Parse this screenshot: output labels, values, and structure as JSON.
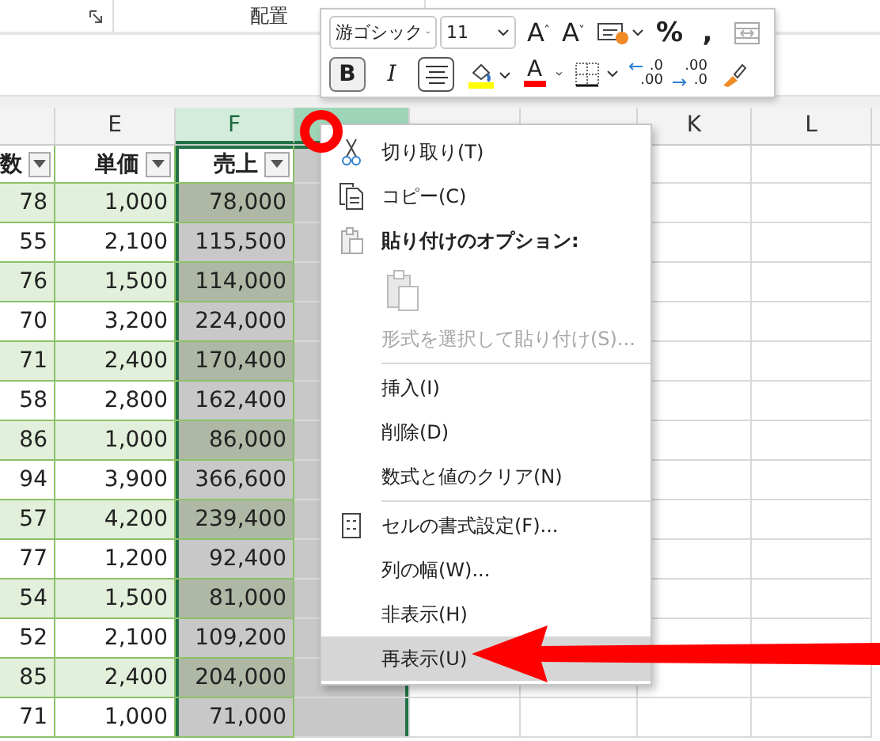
{
  "ribbon": {
    "group_label": "配置"
  },
  "columns": [
    {
      "selected": false,
      "hovered": false
    },
    {
      "letter": "E",
      "selected": false,
      "hovered": false
    },
    {
      "letter": "F",
      "selected": true,
      "hovered": false
    },
    {
      "selected": true,
      "hovered": true
    },
    {
      "selected": false,
      "hovered": false
    },
    {
      "selected": false,
      "hovered": false
    },
    {
      "letter": "K",
      "selected": false,
      "hovered": false
    },
    {
      "letter": "L",
      "selected": false,
      "hovered": false
    }
  ],
  "table": {
    "headers": [
      "数",
      "単価",
      "売上"
    ],
    "rows": [
      {
        "banded": true,
        "cells": [
          "78",
          "1,000",
          "78,000"
        ]
      },
      {
        "banded": false,
        "cells": [
          "55",
          "2,100",
          "115,500"
        ]
      },
      {
        "banded": true,
        "cells": [
          "76",
          "1,500",
          "114,000"
        ]
      },
      {
        "banded": false,
        "cells": [
          "70",
          "3,200",
          "224,000"
        ]
      },
      {
        "banded": true,
        "cells": [
          "71",
          "2,400",
          "170,400"
        ]
      },
      {
        "banded": false,
        "cells": [
          "58",
          "2,800",
          "162,400"
        ]
      },
      {
        "banded": true,
        "cells": [
          "86",
          "1,000",
          "86,000"
        ]
      },
      {
        "banded": false,
        "cells": [
          "94",
          "3,900",
          "366,600"
        ]
      },
      {
        "banded": true,
        "cells": [
          "57",
          "4,200",
          "239,400"
        ]
      },
      {
        "banded": false,
        "cells": [
          "77",
          "1,200",
          "92,400"
        ]
      },
      {
        "banded": true,
        "cells": [
          "54",
          "1,500",
          "81,000"
        ]
      },
      {
        "banded": false,
        "cells": [
          "52",
          "2,100",
          "109,200"
        ]
      },
      {
        "banded": true,
        "cells": [
          "85",
          "2,400",
          "204,000"
        ]
      },
      {
        "banded": false,
        "cells": [
          "71",
          "1,000",
          "71,000"
        ]
      }
    ]
  },
  "mini_toolbar": {
    "row1": [
      {
        "kind": "font",
        "value": "游ゴシック"
      },
      {
        "kind": "size",
        "value": "11"
      },
      {
        "kind": "grow",
        "label": "A"
      },
      {
        "kind": "shrink",
        "label": "A"
      },
      {
        "kind": "cond"
      },
      {
        "kind": "text",
        "label": "%"
      },
      {
        "kind": "text",
        "label": ","
      },
      {
        "kind": "merge"
      }
    ],
    "row2": [
      {
        "kind": "bold",
        "label": "B",
        "pressed": true
      },
      {
        "kind": "italic",
        "label": "I",
        "pressed": false
      },
      {
        "kind": "align",
        "pressed": true
      },
      {
        "kind": "fill",
        "color": "#ffff00"
      },
      {
        "kind": "fontcolor",
        "label": "A",
        "color": "#ff0000"
      },
      {
        "kind": "border"
      },
      {
        "kind": "decimal-decrease",
        "top": ".0",
        "bottom": ".00"
      },
      {
        "kind": "decimal-increase",
        "top": ".00",
        "bottom": ".0"
      },
      {
        "kind": "painter"
      }
    ]
  },
  "context_menu": [
    {
      "kind": "cut",
      "label": "切り取り(T)",
      "disabled": false,
      "selected": false
    },
    {
      "kind": "copy",
      "label": "コピー(C)",
      "disabled": false,
      "selected": false
    },
    {
      "kind": "paste-options",
      "label": "貼り付けのオプション:",
      "disabled": false,
      "selected": false
    },
    {
      "kind": "paste-button",
      "disabled": true,
      "selected": false
    },
    {
      "kind": "plain",
      "label": "形式を選択して貼り付け(S)...",
      "disabled": true,
      "selected": false
    },
    {
      "kind": "separator"
    },
    {
      "kind": "plain",
      "label": "挿入(I)",
      "disabled": false,
      "selected": false
    },
    {
      "kind": "plain",
      "label": "削除(D)",
      "disabled": false,
      "selected": false
    },
    {
      "kind": "plain",
      "label": "数式と値のクリア(N)",
      "disabled": false,
      "selected": false
    },
    {
      "kind": "separator"
    },
    {
      "kind": "format",
      "label": "セルの書式設定(F)...",
      "disabled": false,
      "selected": false
    },
    {
      "kind": "plain",
      "label": "列の幅(W)...",
      "disabled": false,
      "selected": false
    },
    {
      "kind": "plain",
      "label": "非表示(H)",
      "disabled": false,
      "selected": false
    },
    {
      "kind": "plain",
      "label": "再表示(U)",
      "disabled": false,
      "selected": true
    }
  ]
}
